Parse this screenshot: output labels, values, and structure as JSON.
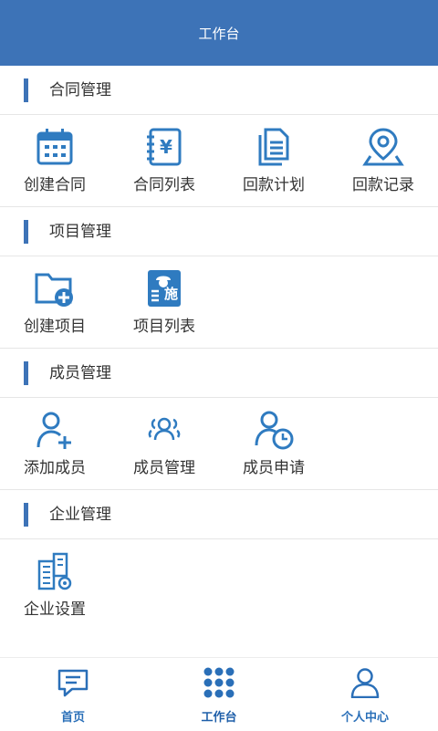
{
  "header": {
    "title": "工作台"
  },
  "colors": {
    "primary": "#3d73b7",
    "icon": "#2f7bc0"
  },
  "sections": [
    {
      "title": "合同管理",
      "items": [
        {
          "label": "创建合同",
          "icon": "calendar-icon"
        },
        {
          "label": "合同列表",
          "icon": "yuan-notebook-icon"
        },
        {
          "label": "回款计划",
          "icon": "documents-icon"
        },
        {
          "label": "回款记录",
          "icon": "location-pin-icon"
        }
      ]
    },
    {
      "title": "项目管理",
      "items": [
        {
          "label": "创建项目",
          "icon": "folder-add-icon"
        },
        {
          "label": "项目列表",
          "icon": "construction-worker-icon",
          "badge": "施"
        }
      ]
    },
    {
      "title": "成员管理",
      "items": [
        {
          "label": "添加成员",
          "icon": "user-add-icon"
        },
        {
          "label": "成员管理",
          "icon": "users-group-icon"
        },
        {
          "label": "成员申请",
          "icon": "user-clock-icon"
        }
      ]
    },
    {
      "title": "企业管理",
      "items": [
        {
          "label": "企业设置",
          "icon": "building-settings-icon"
        }
      ]
    }
  ],
  "tabbar": [
    {
      "label": "首页",
      "icon": "message-icon"
    },
    {
      "label": "工作台",
      "icon": "grid-dots-icon",
      "active": true
    },
    {
      "label": "个人中心",
      "icon": "person-icon"
    }
  ]
}
